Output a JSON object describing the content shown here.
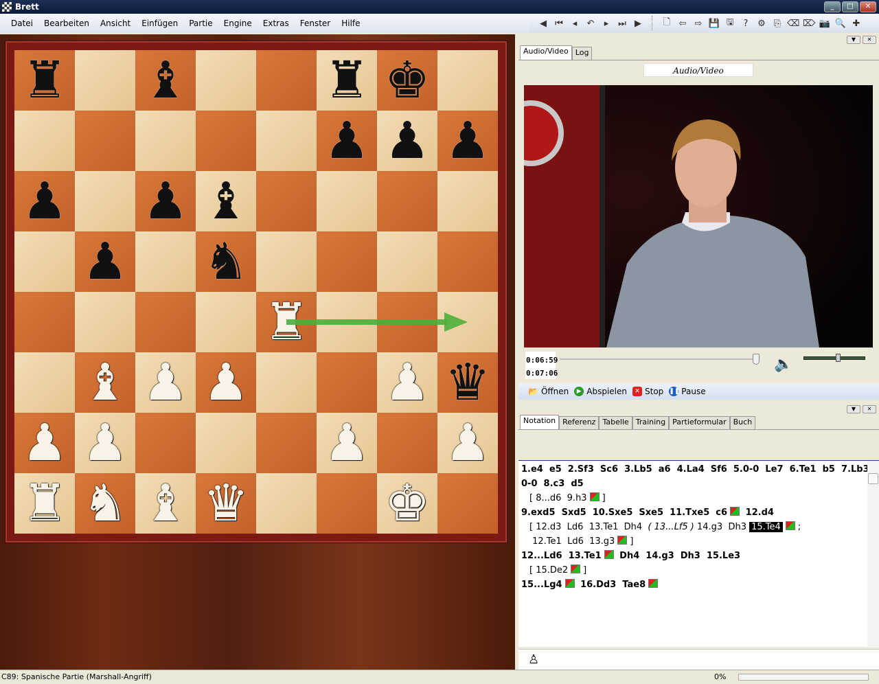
{
  "window": {
    "title": "Brett"
  },
  "menu": [
    "Datei",
    "Bearbeiten",
    "Ansicht",
    "Einfügen",
    "Partie",
    "Engine",
    "Extras",
    "Fenster",
    "Hilfe"
  ],
  "toolbar_icons": [
    "back-circle",
    "first-move",
    "prev-move",
    "undo",
    "next-move",
    "last-move",
    "forward-circle",
    "|",
    "new-doc",
    "arrow-left",
    "arrow-right",
    "save",
    "save-as",
    "info-query",
    "engine-query",
    "replace",
    "eraser",
    "eraser-red",
    "camera",
    "search-doc",
    "color-cross"
  ],
  "board": {
    "pieces": [
      {
        "sq": "a8",
        "p": "r"
      },
      {
        "sq": "c8",
        "p": "b"
      },
      {
        "sq": "f8",
        "p": "r"
      },
      {
        "sq": "g8",
        "p": "k"
      },
      {
        "sq": "f7",
        "p": "p"
      },
      {
        "sq": "g7",
        "p": "p"
      },
      {
        "sq": "h7",
        "p": "p"
      },
      {
        "sq": "a6",
        "p": "p"
      },
      {
        "sq": "c6",
        "p": "p"
      },
      {
        "sq": "d6",
        "p": "b"
      },
      {
        "sq": "b5",
        "p": "p"
      },
      {
        "sq": "d5",
        "p": "n"
      },
      {
        "sq": "e4",
        "p": "R"
      },
      {
        "sq": "b3",
        "p": "B"
      },
      {
        "sq": "c3",
        "p": "P"
      },
      {
        "sq": "d3",
        "p": "P"
      },
      {
        "sq": "g3",
        "p": "P"
      },
      {
        "sq": "h3",
        "p": "q"
      },
      {
        "sq": "a2",
        "p": "P"
      },
      {
        "sq": "b2",
        "p": "P"
      },
      {
        "sq": "f2",
        "p": "P"
      },
      {
        "sq": "h2",
        "p": "P"
      },
      {
        "sq": "a1",
        "p": "R"
      },
      {
        "sq": "b1",
        "p": "N"
      },
      {
        "sq": "c1",
        "p": "B"
      },
      {
        "sq": "d1",
        "p": "Q"
      },
      {
        "sq": "g1",
        "p": "K"
      }
    ],
    "arrow": {
      "from": "e4",
      "to": "h4",
      "color": "#4caf3a"
    }
  },
  "av_panel": {
    "tabs": [
      "Audio/Video",
      "Log"
    ],
    "title": "Audio/Video",
    "time_current": "0:06:59",
    "time_total": "0:07:06",
    "progress": 0.985,
    "volume": 0.55,
    "buttons": {
      "open": "Öffnen",
      "play": "Abspielen",
      "stop": "Stop",
      "pause": "Pause"
    }
  },
  "notation_panel": {
    "tabs": [
      "Notation",
      "Referenz",
      "Tabelle",
      "Training",
      "Partieformular",
      "Buch"
    ]
  },
  "status": {
    "opening": "C89: Spanische Partie (Marshall-Angriff)",
    "progress": "0%"
  }
}
